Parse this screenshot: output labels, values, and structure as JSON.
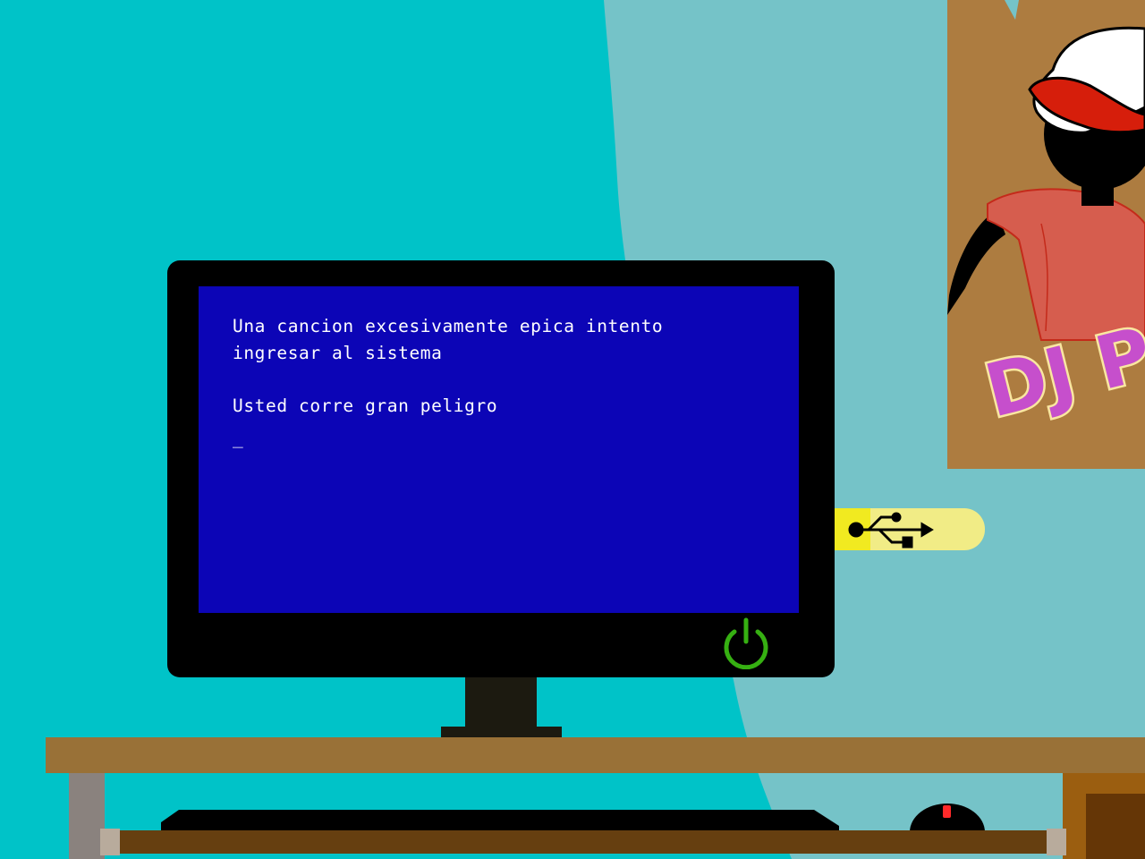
{
  "screen": {
    "message_line1": "Una cancion excesivamente epica intento\ningresar al sistema",
    "message_line2": "Usted corre gran peligro",
    "cursor": "_"
  },
  "poster": {
    "logo_text": "DJ P"
  },
  "colors": {
    "wall": "#00c3c8",
    "wall_light": "#75c3c8",
    "screen_bg": "#0c05b6",
    "screen_text": "#ffffff",
    "power_icon": "#36b012",
    "usb_stick": "#f1ec86",
    "usb_stick_tip": "#f1ea20",
    "poster_bg": "#ad7c40",
    "desk_top": "#997137",
    "logo_fill": "#c64fcc"
  },
  "icons": {
    "power": "power-icon",
    "usb": "usb-icon"
  }
}
